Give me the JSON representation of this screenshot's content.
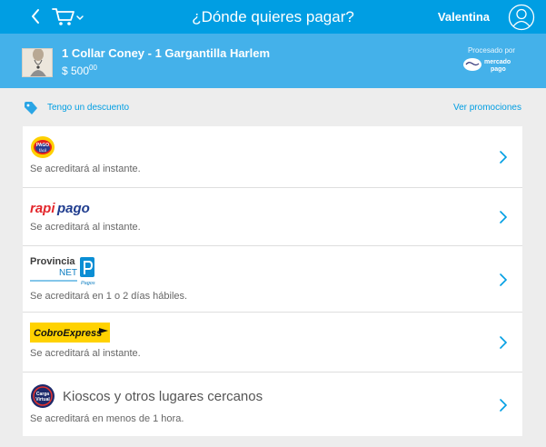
{
  "header": {
    "title": "¿Dónde quieres pagar?",
    "user_name": "Valentina",
    "back_icon": "chevron-left-icon",
    "cart_icon": "shopping-cart-icon",
    "avatar_icon": "user-avatar-icon"
  },
  "order": {
    "product": "1 Collar Coney - 1 Gargantilla Harlem",
    "price_main": "$ 500",
    "price_cents": "00",
    "processed_by": "Procesado por",
    "processor_logo_text": "mercado pago"
  },
  "discount": {
    "label": "Tengo un descuento",
    "promotions_link": "Ver promociones",
    "icon": "tag-icon"
  },
  "payment_methods": [
    {
      "id": "pago-facil",
      "logo_text": "PAGO fácil",
      "description": "Se acreditará al instante."
    },
    {
      "id": "rapipago",
      "logo_text": "rapipago",
      "description": "Se acreditará al instante."
    },
    {
      "id": "provincia-net",
      "logo_text": "Provincia NET Pagos",
      "description": "Se acreditará en 1 o 2 días hábiles."
    },
    {
      "id": "cobro-express",
      "logo_text": "CobroExpress",
      "description": "Se acreditará al instante."
    },
    {
      "id": "kioscos",
      "label": "Kioscos y otros lugares cercanos",
      "logo_text": "Carga Virtual",
      "description": "Se acreditará en menos de 1 hora."
    }
  ],
  "colors": {
    "header_bg": "#009ee3",
    "summary_bg": "#44b1ea",
    "link": "#009ee3",
    "background": "#ededed"
  }
}
